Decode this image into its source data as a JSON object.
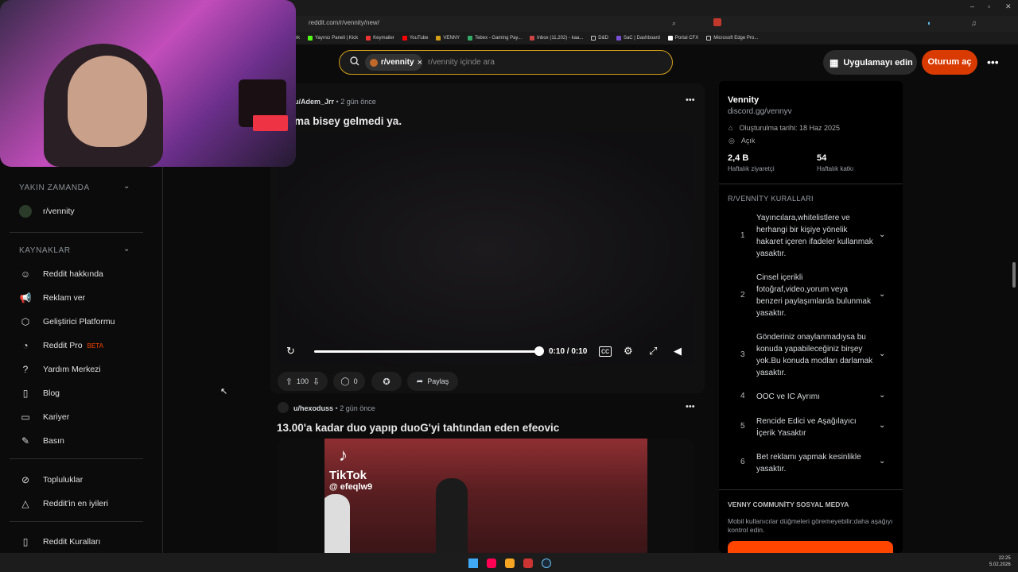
{
  "browser": {
    "url": "reddit.com/r/vennity/new/",
    "bookmarks": [
      "Yayıncı Paneli | Kick",
      "Keymailer",
      "YouTube",
      "VENNY",
      "Tebex - Gaming Pay...",
      "Inbox (11,202) - kaa...",
      "D&D",
      "SaC | Dashboard",
      "Portal CFX",
      "Microsoft Edge Pro..."
    ],
    "bookmark_prefix": "rk"
  },
  "header": {
    "chip_label": "r/vennity",
    "search_placeholder": "r/vennity içinde ara",
    "app_button": "Uygulamayı edin",
    "login_button": "Oturum aç",
    "more": "•••"
  },
  "sidebar": {
    "recent_title": "YAKIN ZAMANDA",
    "recent_items": [
      "r/vennity"
    ],
    "resources_title": "KAYNAKLAR",
    "resources": [
      "Reddit hakkında",
      "Reklam ver",
      "Geliştirici Platformu",
      "Reddit Pro",
      "Yardım Merkezi",
      "Blog",
      "Kariyer",
      "Basın"
    ],
    "pro_badge": "BETA",
    "communities": [
      "Topluluklar",
      "Reddit'in en iyileri"
    ],
    "rules": "Reddit Kuralları"
  },
  "posts": [
    {
      "author": "u/Adem_Jrr",
      "author_visible": "u/Adem_Jrr",
      "time": "2 gün önce",
      "title": "ma bisey gelmedi ya.",
      "video_time": "0:10 / 0:10",
      "votes": "100",
      "comments": "0",
      "share": "Paylaş"
    },
    {
      "author": "u/hexoduss",
      "time": "2 gün önce",
      "title": "13.00'a kadar duo yapıp duoG'yi tahtından eden efeovic",
      "tiktok_label": "TikTok",
      "tiktok_user": "@ efeqlw9"
    }
  ],
  "community": {
    "name": "Vennity",
    "link": "discord.gg/vennyv",
    "created": "Oluşturulma tarihi: 18 Haz 2025",
    "visibility": "Açık",
    "weekly_visitors": "2,4 B",
    "weekly_visitors_label": "Haftalık ziyaretçi",
    "weekly_contrib": "54",
    "weekly_contrib_label": "Haftalık katkı",
    "rules_title": "R/VENNİTY KURALLARI",
    "rules": [
      {
        "num": "1",
        "text": "Yayıncılara,whitelistlere ve herhangi bir kişiye yönelik hakaret içeren ifadeler kullanmak yasaktır."
      },
      {
        "num": "2",
        "text": "Cinsel içerikli fotoğraf,video,yorum veya benzeri paylaşımlarda bulunmak yasaktır."
      },
      {
        "num": "3",
        "text": "Gönderiniz onaylanmadıysa bu konuda yapabileceğiniz birşey yok.Bu konuda modları darlamak yasaktır."
      },
      {
        "num": "4",
        "text": "OOC ve IC Ayrımı"
      },
      {
        "num": "5",
        "text": "Rencide Edici ve Aşağılayıcı İçerik Yasaktır"
      },
      {
        "num": "6",
        "text": "Bet reklamı yapmak kesinlikle yasaktır."
      }
    ],
    "social_title": "VENNY COMMUNİTY SOSYAL MEDYA",
    "social_desc": "Mobil kullanıcılar düğmeleri göremeyebilir;daha aşağıyı kontrol edin."
  },
  "taskbar": {
    "time": "22:25",
    "date": "5.02.2026"
  },
  "colors": {
    "accent": "#d93a00",
    "search_border": "#d4a017",
    "beta": "#ff4500"
  }
}
